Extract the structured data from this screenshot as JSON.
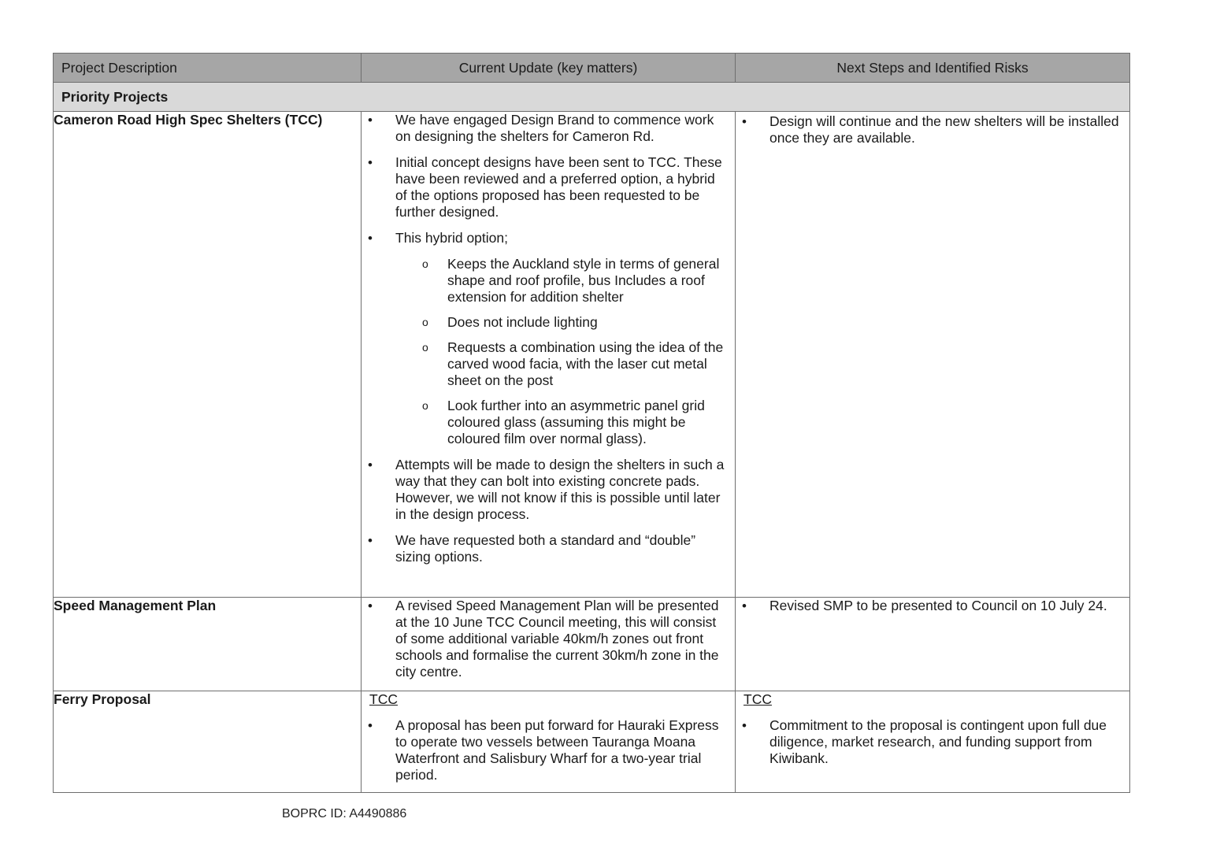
{
  "table": {
    "headers": {
      "project": "Project Description",
      "update": "Current Update (key matters)",
      "next": "Next Steps and Identified Risks"
    },
    "section_title": "Priority Projects",
    "rows": {
      "cameron": {
        "name": "Cameron Road High Spec Shelters (TCC)",
        "update": {
          "b1": "We have engaged Design Brand to commence work on designing the shelters for Cameron Rd.",
          "b2": "Initial concept designs have been sent to TCC. These have been reviewed and a preferred option, a hybrid of the options proposed has been requested to be further designed.",
          "b3": "This hybrid option;",
          "sub": {
            "s1": "Keeps the Auckland style in terms of general shape and roof profile, bus Includes a roof extension for addition shelter",
            "s2": "Does not include lighting",
            "s3": "Requests a combination using the idea of the carved wood facia, with the laser cut metal sheet on the post",
            "s4": "Look further into an asymmetric panel grid coloured glass (assuming this might be coloured film over normal glass)."
          },
          "b4": "Attempts will be made to design the shelters in such a way that they can bolt into existing concrete pads. However, we will not know if this is possible until later in the design process.",
          "b5": "We have requested both a standard and “double” sizing options."
        },
        "next": {
          "b1": "Design will continue and the new shelters will be installed once they are available."
        }
      },
      "speed": {
        "name": "Speed Management Plan",
        "update": {
          "b1": "A revised Speed Management Plan will be presented at the 10 June TCC Council meeting, this will consist of some additional variable 40km/h zones out front schools and formalise the current 30km/h zone in the city centre."
        },
        "next": {
          "b1": "Revised SMP to be presented to Council on 10 July 24."
        }
      },
      "ferry": {
        "name": "Ferry Proposal",
        "update": {
          "org": "TCC",
          "b1": "A proposal has been put forward for Hauraki Express to operate two vessels between Tauranga Moana Waterfront and Salisbury Wharf for a two-year trial period."
        },
        "next": {
          "org": "TCC",
          "b1": "Commitment to the proposal is contingent upon full due diligence, market research, and funding support from Kiwibank."
        }
      }
    }
  },
  "footer": {
    "doc_id": "BOPRC ID: A4490886"
  }
}
